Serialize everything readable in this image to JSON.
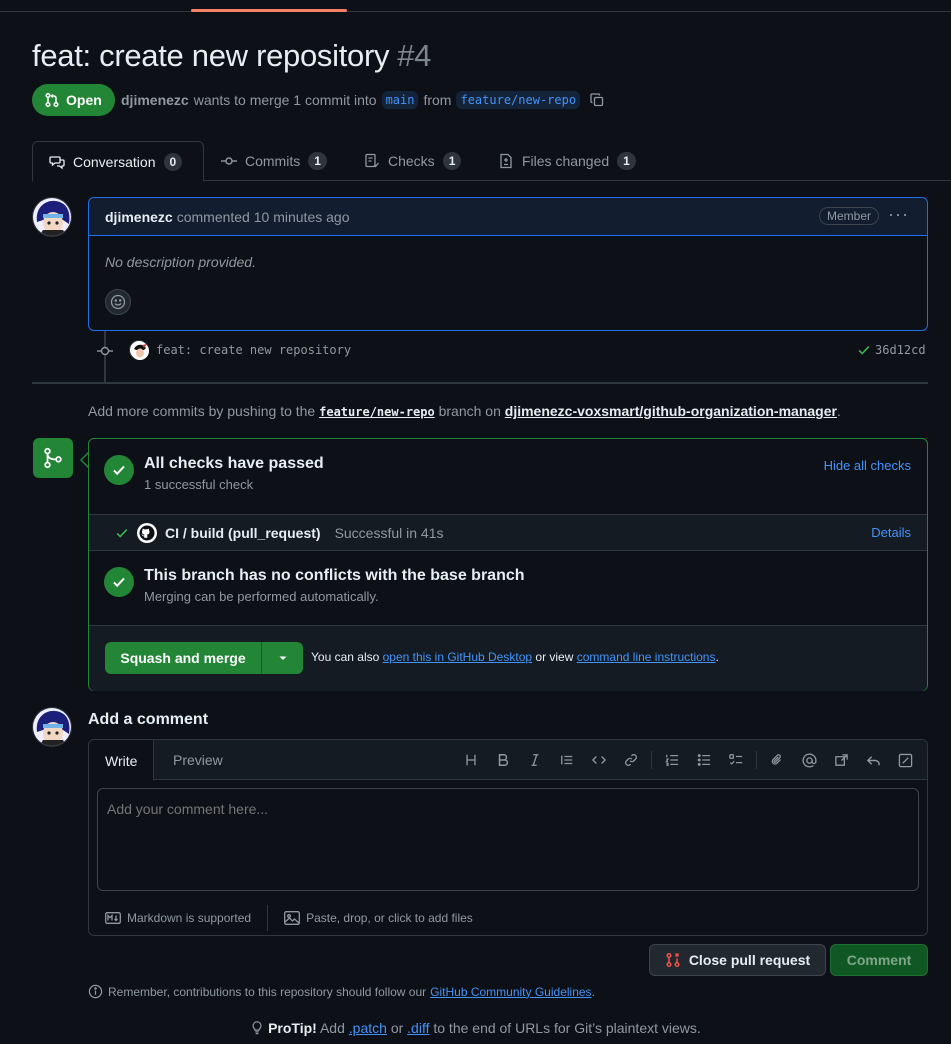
{
  "pr": {
    "title": "feat: create new repository",
    "number": "#4",
    "state": "Open",
    "author": "djimenezc",
    "merge_text": "wants to merge 1 commit into",
    "base_branch": "main",
    "from_text": "from",
    "head_branch": "feature/new-repo"
  },
  "tabs": [
    {
      "label": "Conversation",
      "count": "0"
    },
    {
      "label": "Commits",
      "count": "1"
    },
    {
      "label": "Checks",
      "count": "1"
    },
    {
      "label": "Files changed",
      "count": "1"
    }
  ],
  "comment": {
    "author": "djimenezc",
    "action": "commented",
    "time": "10 minutes ago",
    "role": "Member",
    "body": "No description provided."
  },
  "commit": {
    "message": "feat: create new repository",
    "sha": "36d12cd"
  },
  "push_hint": {
    "prefix": "Add more commits by pushing to the",
    "branch": "feature/new-repo",
    "middle": "branch on",
    "repo": "djimenezc-voxsmart/github-organization-manager",
    "suffix": "."
  },
  "checks": {
    "title": "All checks have passed",
    "subtitle": "1 successful check",
    "hide_link": "Hide all checks",
    "item_name": "CI / build (pull_request)",
    "item_status": "Successful in 41s",
    "details_link": "Details"
  },
  "conflicts": {
    "title": "This branch has no conflicts with the base branch",
    "subtitle": "Merging can be performed automatically."
  },
  "merge": {
    "button": "Squash and merge",
    "also_prefix": "You can also",
    "desktop_link": "open this in GitHub Desktop",
    "or_view": "or view",
    "cli_link": "command line instructions",
    "suffix": "."
  },
  "add_comment": {
    "title": "Add a comment",
    "tab_write": "Write",
    "tab_preview": "Preview",
    "placeholder": "Add your comment here...",
    "markdown": "Markdown is supported",
    "attach": "Paste, drop, or click to add files"
  },
  "actions": {
    "close": "Close pull request",
    "comment": "Comment"
  },
  "footer": {
    "guidelines_prefix": "Remember, contributions to this repository should follow our",
    "guidelines_link": "GitHub Community Guidelines",
    "guidelines_suffix": ".",
    "protip_label": "ProTip!",
    "protip_add": "Add",
    "patch": ".patch",
    "or": "or",
    "diff": ".diff",
    "protip_rest": "to the end of URLs for Git’s plaintext views."
  },
  "colors": {
    "accent_green": "#238636",
    "link_blue": "#4493f8",
    "bg": "#0d1117"
  }
}
